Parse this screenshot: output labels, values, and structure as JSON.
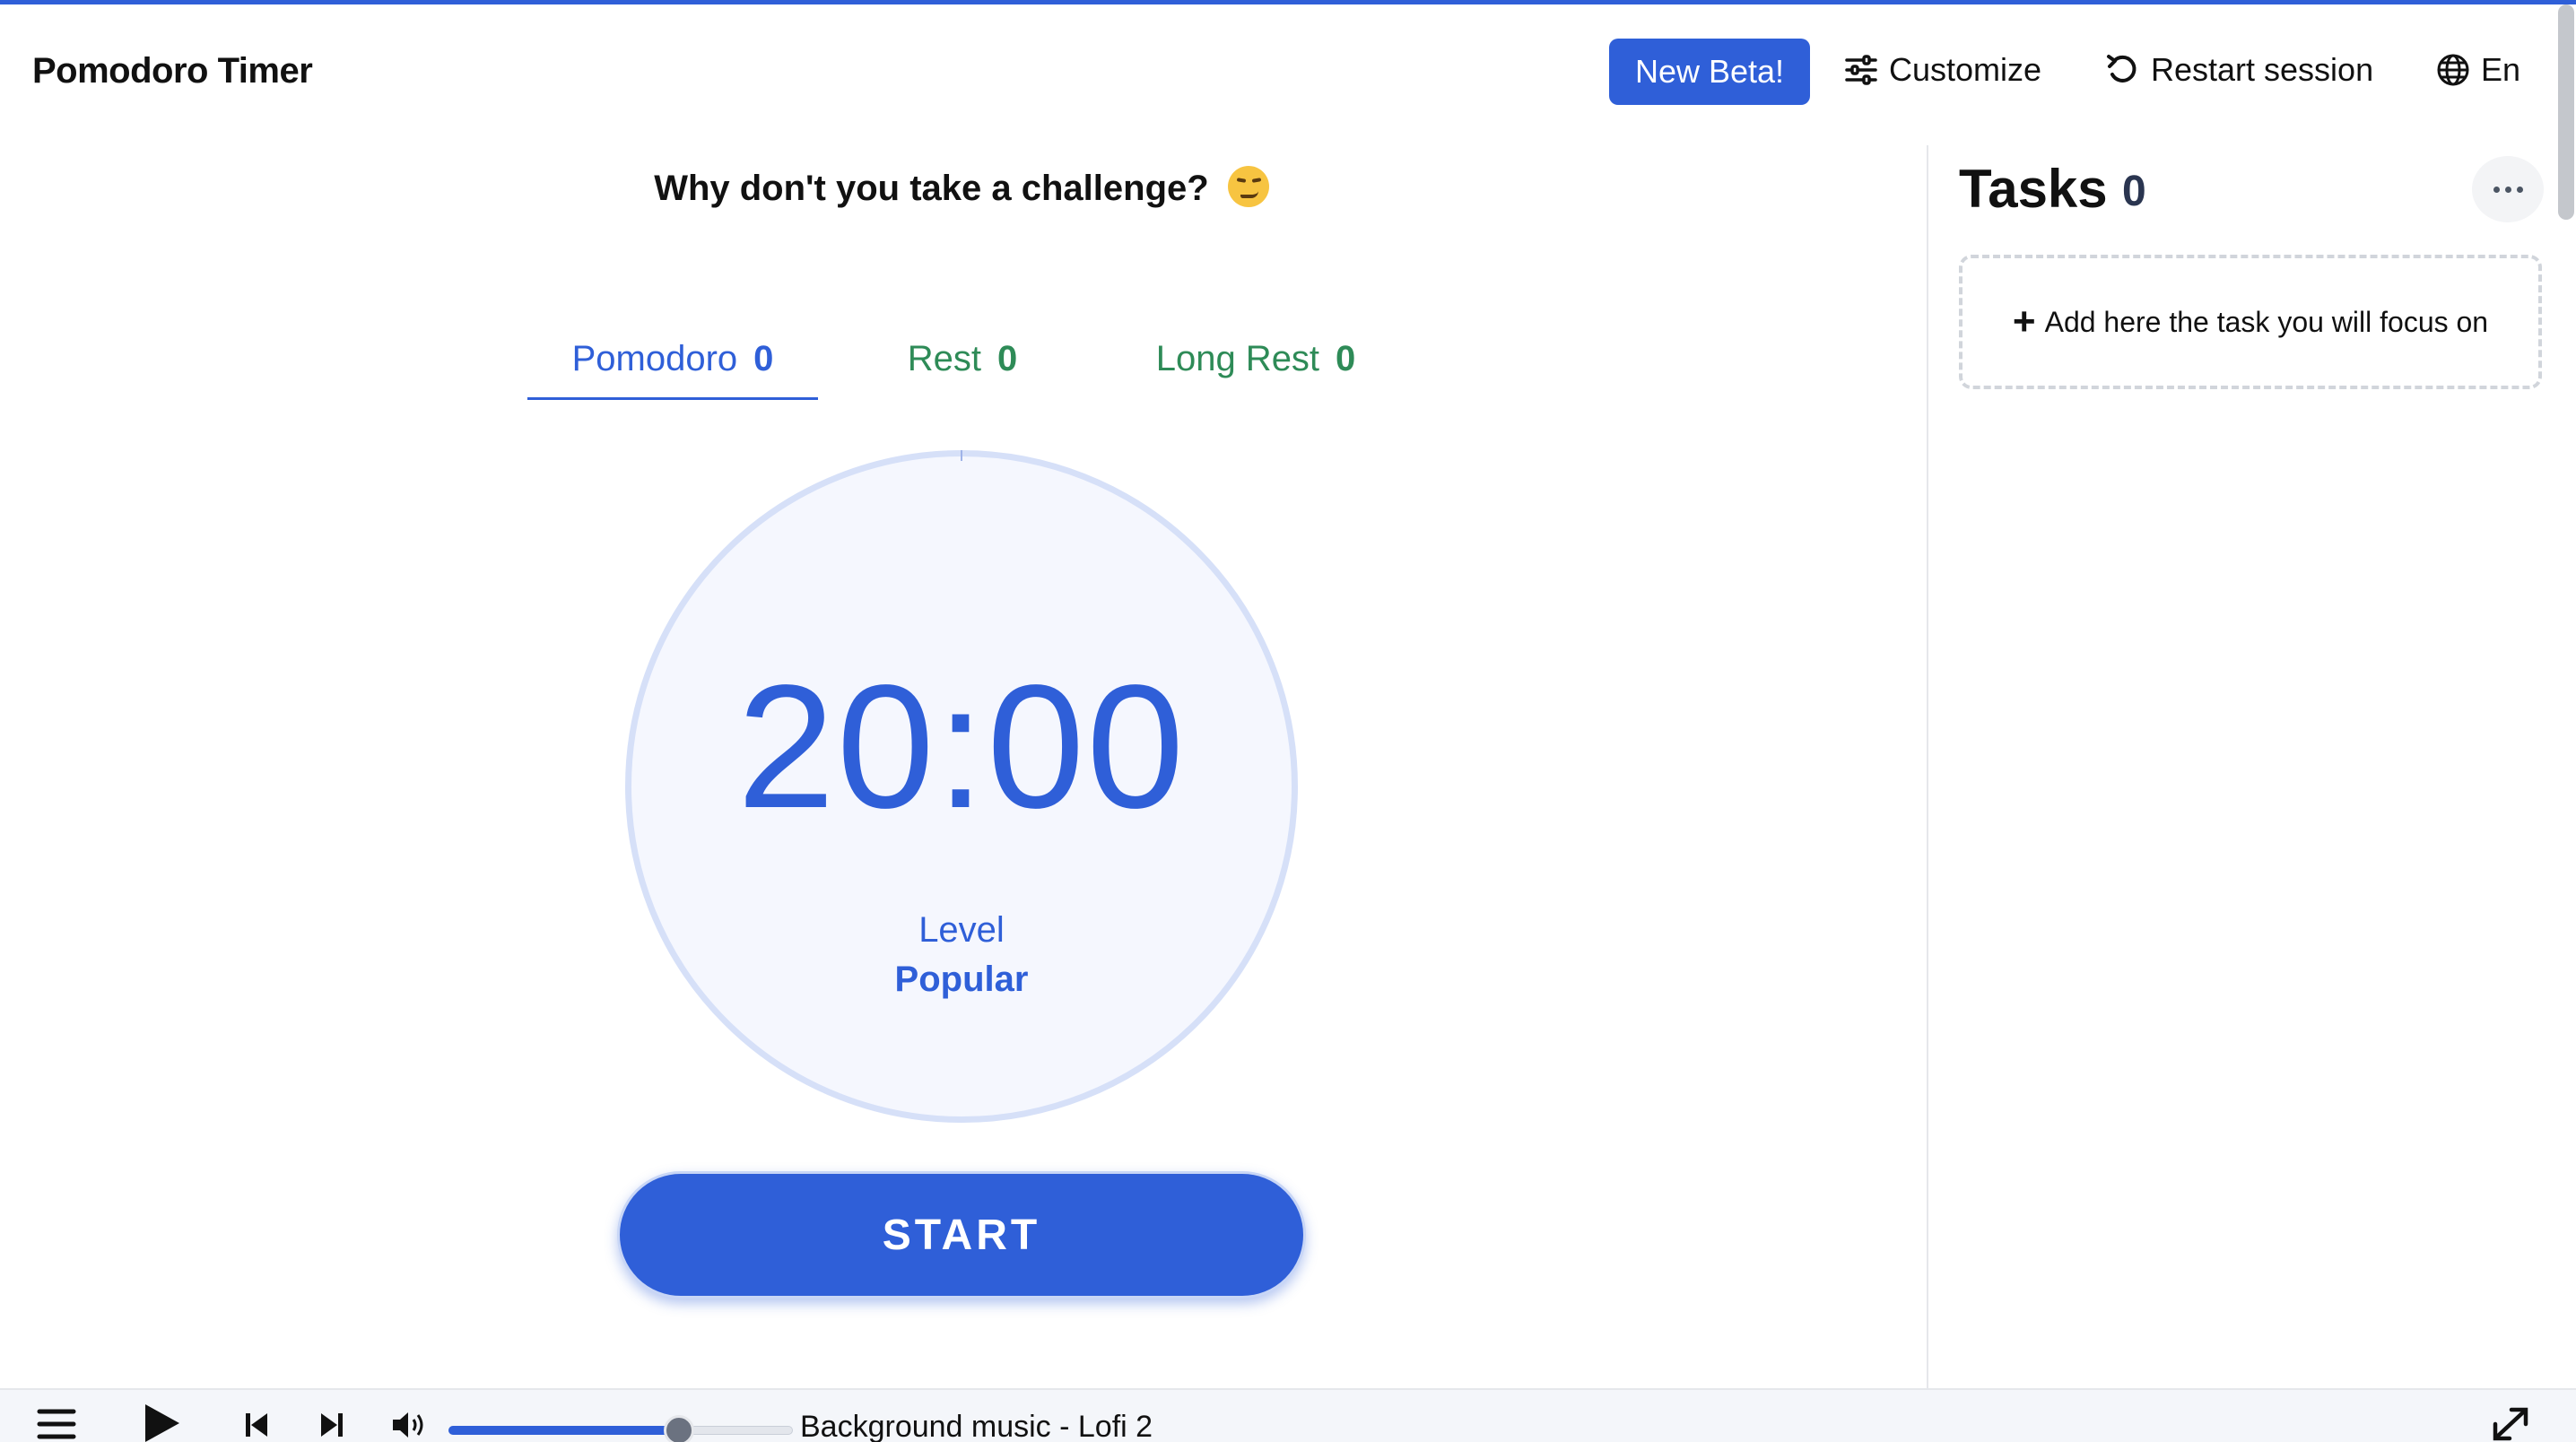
{
  "header": {
    "app_title": "Pomodoro Timer",
    "beta_label": "New Beta!",
    "customize_label": "Customize",
    "restart_label": "Restart session",
    "language_label": "En"
  },
  "main": {
    "challenge_text": "Why don't you take a challenge?",
    "tabs": [
      {
        "label": "Pomodoro",
        "count": "0",
        "active": true
      },
      {
        "label": "Rest",
        "count": "0",
        "active": false
      },
      {
        "label": "Long Rest",
        "count": "0",
        "active": false
      }
    ],
    "timer": {
      "time": "20:00",
      "level_label": "Level",
      "level_value": "Popular"
    },
    "start_label": "START"
  },
  "tasks": {
    "title": "Tasks",
    "count": "0",
    "add_placeholder": "Add here the task you will focus on"
  },
  "player": {
    "track_name": "Background music - Lofi 2",
    "volume": 0.67
  },
  "colors": {
    "accent": "#2f5fd8",
    "rest_green": "#2e8b57",
    "dial_bg": "#f5f7fe",
    "dial_ring": "#d6e0f8"
  },
  "icons": {
    "customize": "sliders-icon",
    "restart": "restart-icon",
    "language": "globe-icon",
    "tasks_menu": "more-icon",
    "add": "plus-icon",
    "challenge_emoji": "smirk-emoji-icon",
    "player": [
      "menu-icon",
      "play-icon",
      "previous-icon",
      "next-icon",
      "volume-icon",
      "expand-icon"
    ]
  }
}
